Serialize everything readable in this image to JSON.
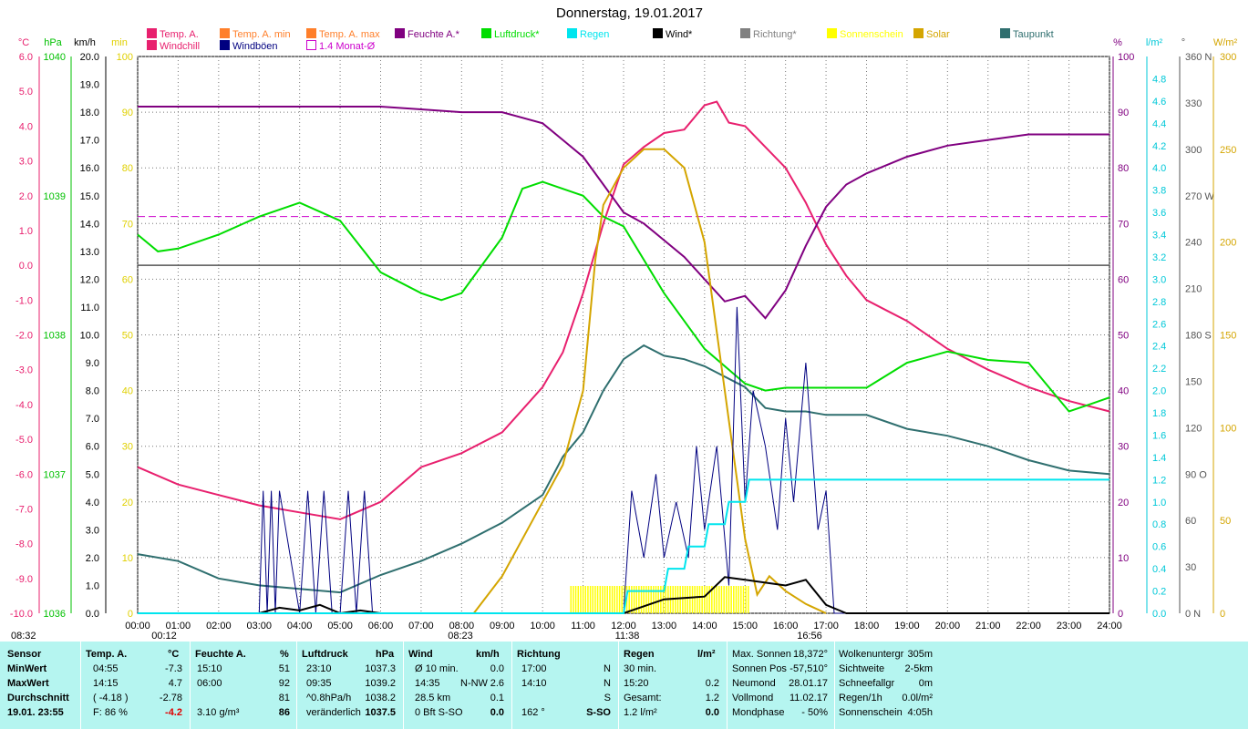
{
  "title": "Donnerstag, 19.01.2017",
  "legend": [
    {
      "name": "Temp. A.",
      "color": "#e8206e"
    },
    {
      "name": "Windchill",
      "color": "#e8206e"
    },
    {
      "name": "Temp. A. min",
      "color": "#ff7f2a"
    },
    {
      "name": "Windböen",
      "color": "#000080"
    },
    {
      "name": "Temp. A. max",
      "color": "#ff7f2a"
    },
    {
      "name": "1.4 Monat-Ø",
      "color": "#cc00cc"
    },
    {
      "name": "Feuchte A.*",
      "color": "#800080"
    },
    {
      "name": "Luftdruck*",
      "color": "#00dd00"
    },
    {
      "name": "Regen",
      "color": "#00e5ee"
    },
    {
      "name": "Wind*",
      "color": "#000000"
    },
    {
      "name": "Richtung*",
      "color": "#808080"
    },
    {
      "name": "Sonnenschein",
      "color": "#ffff00"
    },
    {
      "name": "Solar",
      "color": "#d4a500"
    },
    {
      "name": "Taupunkt",
      "color": "#2f6f6f"
    }
  ],
  "axis_units": {
    "temp": "°C",
    "pressure": "hPa",
    "wind": "km/h",
    "sun": "min",
    "hum": "%",
    "rain": "l/m²",
    "dir": "°",
    "solar": "W/m²"
  },
  "markers": {
    "left": "08:32",
    "t1": "00:12",
    "t2": "08:23",
    "t3": "11:38",
    "t4": "16:56"
  },
  "chart_data": {
    "type": "line",
    "title": "Donnerstag, 19.01.2017",
    "x_range": [
      "00:00",
      "24:00"
    ],
    "x_ticks": [
      "00:00",
      "01:00",
      "02:00",
      "03:00",
      "04:00",
      "05:00",
      "06:00",
      "07:00",
      "08:00",
      "09:00",
      "10:00",
      "11:00",
      "12:00",
      "13:00",
      "14:00",
      "15:00",
      "16:00",
      "17:00",
      "18:00",
      "19:00",
      "20:00",
      "21:00",
      "22:00",
      "23:00",
      "24:00"
    ],
    "axes": {
      "temp": {
        "unit": "°C",
        "range": [
          -10.0,
          6.0
        ],
        "ticks": [
          "6.0",
          "5.0",
          "4.0",
          "3.0",
          "2.0",
          "1.0",
          "0.0",
          "-1.0",
          "-2.0",
          "-3.0",
          "-4.0",
          "-5.0",
          "-6.0",
          "-7.0",
          "-8.0",
          "-9.0",
          "-10.0"
        ]
      },
      "pressure": {
        "unit": "hPa",
        "range": [
          1036,
          1040
        ],
        "ticks": [
          "1040",
          "1039",
          "1038",
          "1037",
          "1036"
        ]
      },
      "wind": {
        "unit": "km/h",
        "range": [
          0,
          20
        ],
        "ticks": [
          "20.0",
          "19.0",
          "18.0",
          "17.0",
          "16.0",
          "15.0",
          "14.0",
          "13.0",
          "12.0",
          "11.0",
          "10.0",
          "9.0",
          "8.0",
          "7.0",
          "6.0",
          "5.0",
          "4.0",
          "3.0",
          "2.0",
          "1.0",
          "0.0"
        ]
      },
      "sun": {
        "unit": "min",
        "range": [
          0,
          100
        ],
        "ticks": [
          "100",
          "90",
          "80",
          "70",
          "60",
          "50",
          "40",
          "30",
          "20",
          "10",
          "0"
        ]
      },
      "hum": {
        "unit": "%",
        "range": [
          0,
          100
        ],
        "ticks": [
          "100",
          "90",
          "80",
          "70",
          "60",
          "50",
          "40",
          "30",
          "20",
          "10",
          "0"
        ]
      },
      "rain": {
        "unit": "l/m²",
        "range": [
          0,
          5
        ],
        "ticks": [
          "4.8",
          "4.6",
          "4.4",
          "4.2",
          "4.0",
          "3.8",
          "3.6",
          "3.4",
          "3.2",
          "3.0",
          "2.8",
          "2.6",
          "2.4",
          "2.2",
          "2.0",
          "1.8",
          "1.6",
          "1.4",
          "1.2",
          "1.0",
          "0.8",
          "0.6",
          "0.4",
          "0.2",
          "0.0"
        ]
      },
      "dir": {
        "unit": "°",
        "range": [
          0,
          360
        ],
        "ticks": [
          "360 N",
          "330",
          "300",
          "270 W",
          "240",
          "210",
          "180 S",
          "150",
          "120",
          "90 O",
          "60",
          "30",
          "0 N"
        ]
      },
      "solar": {
        "unit": "W/m²",
        "range": [
          0,
          300
        ],
        "ticks": [
          "300",
          "250",
          "200",
          "150",
          "100",
          "50",
          "0"
        ]
      }
    },
    "monthly_avg_temp": 1.4,
    "series": [
      {
        "name": "Temp. A.",
        "axis": "temp",
        "x": [
          0,
          1,
          2,
          3,
          4,
          5,
          6,
          7,
          8,
          9,
          10,
          10.5,
          11,
          11.5,
          12,
          12.5,
          13,
          13.5,
          14,
          14.3,
          14.6,
          15,
          15.5,
          16,
          16.5,
          17,
          17.5,
          18,
          18.5,
          19,
          20,
          21,
          22,
          23,
          24
        ],
        "y": [
          -5.8,
          -6.3,
          -6.6,
          -6.9,
          -7.1,
          -7.3,
          -6.8,
          -5.8,
          -5.4,
          -4.8,
          -3.5,
          -2.5,
          -0.8,
          1.2,
          2.9,
          3.4,
          3.8,
          3.9,
          4.6,
          4.7,
          4.1,
          4.0,
          3.4,
          2.8,
          1.8,
          0.6,
          -0.3,
          -1.0,
          -1.3,
          -1.6,
          -2.4,
          -3.0,
          -3.5,
          -3.9,
          -4.2
        ]
      },
      {
        "name": "Feuchte A.*",
        "axis": "hum",
        "x": [
          0,
          1,
          2,
          3,
          4,
          5,
          6,
          7,
          8,
          9,
          10,
          10.5,
          11,
          11.5,
          12,
          12.5,
          13,
          13.5,
          14,
          14.5,
          15,
          15.5,
          16,
          16.5,
          17,
          17.5,
          18,
          19,
          20,
          21,
          22,
          23,
          24
        ],
        "y": [
          91,
          91,
          91,
          91,
          91,
          91,
          91,
          90.5,
          90,
          90,
          88,
          85,
          82,
          77,
          72,
          70,
          67,
          64,
          60,
          56,
          57,
          53,
          58,
          66,
          73,
          77,
          79,
          82,
          84,
          85,
          86,
          86,
          86
        ]
      },
      {
        "name": "Luftdruck*",
        "axis": "pressure",
        "x": [
          0,
          0.5,
          1,
          2,
          3,
          4,
          5,
          6,
          7,
          7.5,
          8,
          9,
          9.5,
          10,
          11,
          11.5,
          12,
          13,
          14,
          15,
          15.5,
          16,
          17,
          18,
          19,
          20,
          21,
          22,
          23,
          23.5,
          24
        ],
        "y": [
          1038.72,
          1038.6,
          1038.62,
          1038.72,
          1038.85,
          1038.95,
          1038.82,
          1038.45,
          1038.3,
          1038.25,
          1038.3,
          1038.7,
          1039.05,
          1039.1,
          1039.0,
          1038.85,
          1038.78,
          1038.3,
          1037.9,
          1037.65,
          1037.6,
          1037.62,
          1037.62,
          1037.62,
          1037.8,
          1037.88,
          1037.82,
          1037.8,
          1037.45,
          1037.5,
          1037.55
        ]
      },
      {
        "name": "Taupunkt",
        "axis": "temp",
        "x": [
          0,
          1,
          2,
          3,
          4,
          5,
          6,
          7,
          8,
          9,
          10,
          10.5,
          11,
          11.5,
          12,
          12.5,
          13,
          13.5,
          14,
          15,
          15.5,
          16,
          16.5,
          17,
          18,
          19,
          20,
          21,
          22,
          23,
          24
        ],
        "y": [
          -8.3,
          -8.5,
          -9.0,
          -9.2,
          -9.3,
          -9.4,
          -8.9,
          -8.5,
          -8.0,
          -7.4,
          -6.6,
          -5.5,
          -4.8,
          -3.6,
          -2.7,
          -2.3,
          -2.6,
          -2.7,
          -2.9,
          -3.5,
          -4.1,
          -4.2,
          -4.2,
          -4.3,
          -4.3,
          -4.7,
          -4.9,
          -5.2,
          -5.6,
          -5.9,
          -6.0
        ]
      },
      {
        "name": "Solar",
        "axis": "solar",
        "x": [
          8.3,
          9,
          10,
          10.5,
          11,
          11.3,
          11.5,
          12,
          12.5,
          13,
          13.5,
          14,
          14.5,
          15,
          15.3,
          15.6,
          16,
          16.5,
          17
        ],
        "y": [
          0,
          20,
          60,
          80,
          120,
          190,
          220,
          240,
          250,
          250,
          240,
          200,
          120,
          40,
          10,
          20,
          12,
          5,
          0
        ]
      },
      {
        "name": "Windböen",
        "axis": "wind",
        "x": [
          0,
          3,
          3.1,
          3.2,
          3.3,
          3.4,
          3.5,
          4,
          4.2,
          4.4,
          4.6,
          4.8,
          5,
          5.2,
          5.4,
          5.6,
          5.8,
          6,
          12,
          12.2,
          12.5,
          12.8,
          13,
          13.3,
          13.6,
          13.8,
          14,
          14.3,
          14.6,
          14.8,
          15,
          15.2,
          15.5,
          15.8,
          16,
          16.2,
          16.5,
          16.8,
          17,
          17.2,
          24
        ],
        "y": [
          0,
          0,
          4.4,
          0,
          4.4,
          0,
          4.4,
          0,
          4.4,
          0,
          4.4,
          0,
          0,
          4.4,
          0,
          4.4,
          0,
          0,
          0,
          4.4,
          2,
          5,
          2,
          4,
          2,
          6,
          3,
          6,
          1,
          11,
          4,
          8,
          6,
          3,
          7,
          4,
          9,
          3,
          4.4,
          0,
          0
        ]
      },
      {
        "name": "Wind*",
        "axis": "wind",
        "x": [
          0,
          3,
          3.5,
          4,
          4.5,
          5,
          5.5,
          6,
          12,
          13,
          14,
          14.5,
          15,
          15.5,
          16,
          16.5,
          17,
          17.5,
          24
        ],
        "y": [
          0,
          0,
          0.2,
          0.1,
          0.3,
          0,
          0.1,
          0,
          0,
          0.5,
          0.6,
          1.3,
          1.2,
          1.1,
          1.0,
          1.2,
          0.3,
          0,
          0
        ]
      },
      {
        "name": "Regen",
        "axis": "rain",
        "x": [
          0,
          12,
          12.1,
          13,
          13.1,
          13.5,
          13.6,
          14,
          14.1,
          14.5,
          14.6,
          15,
          15.1,
          15.5,
          15.6,
          24
        ],
        "y": [
          0,
          0,
          0.2,
          0.2,
          0.4,
          0.4,
          0.6,
          0.6,
          0.8,
          0.8,
          1.0,
          1.0,
          1.2,
          1.2,
          1.2,
          1.2
        ]
      }
    ],
    "sunshine_bars": {
      "from": 10.7,
      "to": 15.1
    }
  },
  "stats": {
    "headers": {
      "sensor": "Sensor",
      "temp": "Temp. A.",
      "temp_unit": "°C",
      "hum": "Feuchte A.",
      "hum_unit": "%",
      "press": "Luftdruck",
      "press_unit": "hPa",
      "wind": "Wind",
      "wind_unit": "km/h",
      "dir": "Richtung",
      "rain": "Regen",
      "rain_unit": "l/m²"
    },
    "rows": [
      {
        "label": "MinWert",
        "temp_t": "04:55",
        "temp_v": "-7.3",
        "hum_t": "15:10",
        "hum_v": "51",
        "press_t": "23:10",
        "press_v": "1037.3",
        "wind_t": "Ø 10 min.",
        "wind_v": "0.0",
        "dir_t": "17:00",
        "dir_v": "N",
        "rain_t": "30 min.",
        "rain_v": ""
      },
      {
        "label": "MaxWert",
        "temp_t": "14:15",
        "temp_v": "4.7",
        "hum_t": "06:00",
        "hum_v": "92",
        "press_t": "09:35",
        "press_v": "1039.2",
        "wind_t": "14:35",
        "wind_m": "N-NW",
        "wind_v": "2.6",
        "dir_t": "14:10",
        "dir_v": "N",
        "rain_t": "15:20",
        "rain_v": "0.2"
      },
      {
        "label": "Durchschnitt",
        "temp_t": "( -4.18 )",
        "temp_v": "-2.78",
        "hum_t": "",
        "hum_v": "81",
        "press_t": "^0.8hPa/h",
        "press_v": "1038.2",
        "wind_t": "28.5 km",
        "wind_v": "0.1",
        "dir_t": "",
        "dir_v": "S",
        "rain_t": "Gesamt:",
        "rain_v": "1.2"
      },
      {
        "label": "19.01. 23:55",
        "temp_t": "F: 86 %",
        "temp_v": "-4.2",
        "hum_t": "3.10 g/m³",
        "hum_v": "86",
        "press_t": "veränderlich",
        "press_v": "1037.5",
        "wind_t": "0 Bft S-SO",
        "wind_v": "0.0",
        "dir_t": "162 °",
        "dir_v": "S-SO",
        "rain_t": "1.2 l/m²",
        "rain_v": "0.0"
      }
    ],
    "astro": [
      {
        "k": "Max. Sonnen",
        "v": "18,372°"
      },
      {
        "k": "Sonnen Pos",
        "v": "-57,510°"
      },
      {
        "k": "Neumond",
        "v": "28.01.17"
      },
      {
        "k": "Vollmond",
        "v": "11.02.17"
      },
      {
        "k": "Mondphase",
        "v": "- 50%"
      }
    ],
    "misc": [
      {
        "k": "Wolkenuntergr",
        "v": "305m"
      },
      {
        "k": "Sichtweite",
        "v": "2-5km"
      },
      {
        "k": "Schneefallgr",
        "v": "0m"
      },
      {
        "k": "Regen/1h",
        "v": "0.0l/m²"
      },
      {
        "k": "Sonnenschein",
        "v": "4:05h"
      }
    ]
  }
}
